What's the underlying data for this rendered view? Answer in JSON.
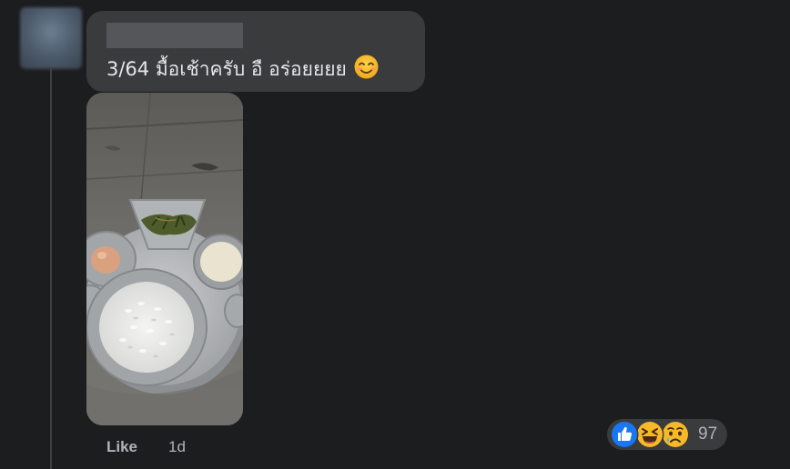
{
  "comment": {
    "author_name": "",
    "text": "3/64 มื้อเช้าครับ อื อร่อยยยย",
    "emoji": "smiling-face-icon"
  },
  "actions": {
    "like_label": "Like",
    "timestamp": "1d"
  },
  "reactions": {
    "types": [
      "like-icon",
      "haha-icon",
      "sad-icon"
    ],
    "count": "97"
  },
  "colors": {
    "background": "#1c1d1f",
    "bubble": "#3a3b3c",
    "text": "#e4e6eb",
    "secondary_text": "#b0b3b8",
    "like_blue": "#1877f2",
    "reaction_yellow": "#f7b928"
  }
}
